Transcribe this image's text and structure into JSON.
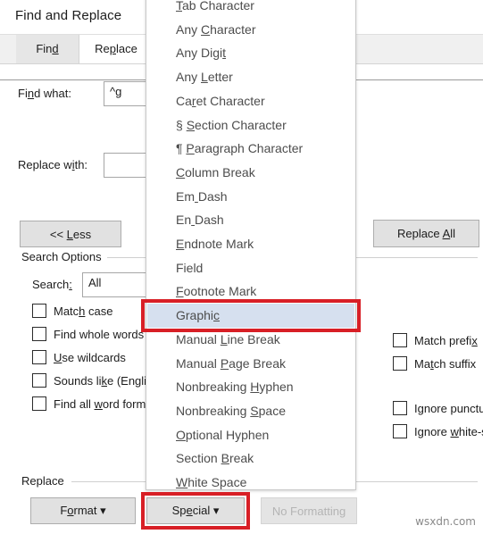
{
  "dialog": {
    "title": "Find and Replace",
    "tabs": [
      {
        "label": "Fin",
        "acc": "d",
        "tail": "",
        "active": false,
        "name": "tab-find"
      },
      {
        "label": "Re",
        "acc": "p",
        "tail": "lace",
        "active": true,
        "name": "tab-replace"
      }
    ],
    "find_what": {
      "label": "Find what:",
      "value": "^g"
    },
    "replace_with": {
      "label": "Replace with:",
      "value": ""
    },
    "less_button": "<< Less",
    "replace_all_button": "Replace All",
    "search_options": {
      "group_label": "Search Options",
      "search_label": "Search:",
      "search_value": "All",
      "left_checkboxes": [
        "Match case",
        "Find whole words",
        "Use wildcards",
        "Sounds like (Englis",
        "Find all word form"
      ],
      "right_checkboxes": [
        "Match prefix",
        "Match suffix",
        "Ignore punctu",
        "Ignore white-s"
      ]
    },
    "replace_group": {
      "group_label": "Replace",
      "format_button": "Format",
      "special_button": "Special",
      "no_formatting_button": "No Formatting"
    }
  },
  "special_menu": {
    "items": [
      "Tab Character",
      "Any Character",
      "Any Digit",
      "Any Letter",
      "Caret Character",
      "§ Section Character",
      "¶ Paragraph Character",
      "Column Break",
      "Em Dash",
      "En Dash",
      "Endnote Mark",
      "Field",
      "Footnote Mark",
      "Graphic",
      "Manual Line Break",
      "Manual Page Break",
      "Nonbreaking Hyphen",
      "Nonbreaking Space",
      "Optional Hyphen",
      "Section Break",
      "White Space"
    ],
    "selected_index": 13,
    "selected_label": "Graphic"
  },
  "annotations": {
    "highlight_color": "#d81f26",
    "boxes": [
      "graphic-menu-item",
      "special-button"
    ]
  },
  "watermark": "wsxdn.com"
}
